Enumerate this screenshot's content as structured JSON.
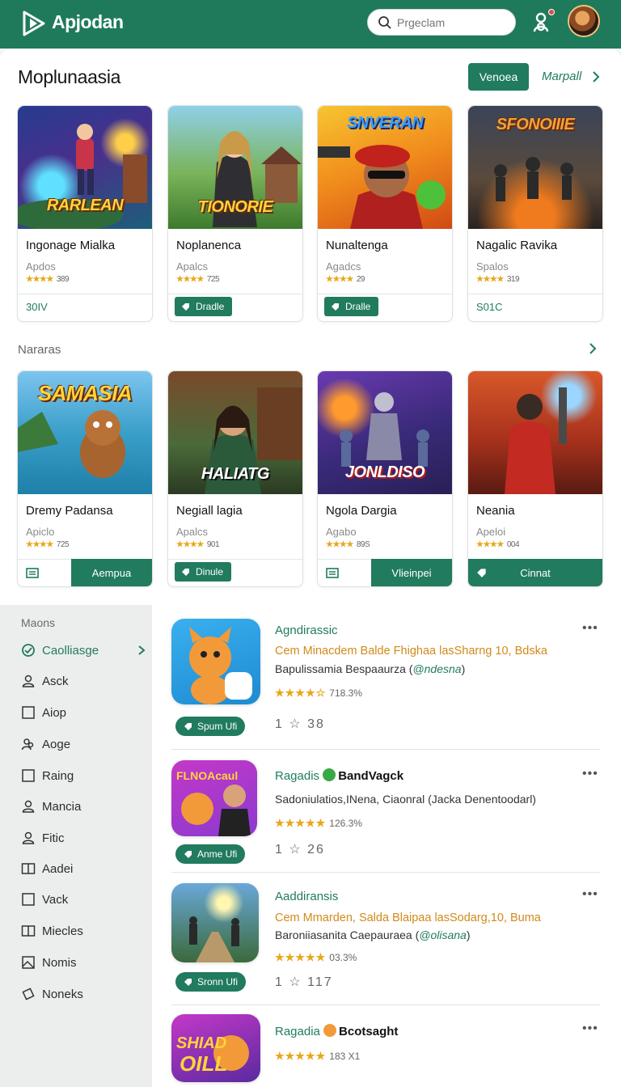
{
  "header": {
    "app_name": "Apjodan",
    "search_placeholder": "Prgeclam",
    "brand_color": "#1f7a5c"
  },
  "featured": {
    "title": "Moplunaasia",
    "view_button": "Venoea",
    "more_link": "Marpall",
    "cards": [
      {
        "art_text": "RARLEAN",
        "title": "Ingonage Mialka",
        "sub": "Apdos",
        "rating": "★★★★",
        "rating_count": "389",
        "action": "30IV",
        "action_type": "price"
      },
      {
        "art_text": "TIONORIE",
        "title": "Noplanenca",
        "sub": "Apalcs",
        "rating": "★★★★",
        "rating_count": "725",
        "action": "Dradle",
        "action_type": "pill"
      },
      {
        "art_text": "SNVERAN",
        "title": "Nunaltenga",
        "sub": "Agadcs",
        "rating": "★★★★",
        "rating_count": "29",
        "action": "Dralle",
        "action_type": "pill"
      },
      {
        "art_text": "SFONOIIIE",
        "title": "Nagalic Ravika",
        "sub": "Spalos",
        "rating": "★★★★",
        "rating_count": "319",
        "action": "S01C",
        "action_type": "price"
      }
    ]
  },
  "secondary": {
    "title": "Nararas",
    "cards": [
      {
        "art_text": "SAMASIA",
        "title": "Dremy Padansa",
        "sub": "Apiclo",
        "rating": "★★★★",
        "rating_count": "725",
        "action": "Aempua",
        "action_type": "wide"
      },
      {
        "art_text": "HALIATG",
        "title": "Negiall lagia",
        "sub": "Apalcs",
        "rating": "★★★★",
        "rating_count": "901",
        "action": "Dinule",
        "action_type": "pill"
      },
      {
        "art_text": "JONLDISO",
        "title": "Ngola Dargia",
        "sub": "Agabo",
        "rating": "★★★★",
        "rating_count": "89S",
        "action": "Vlieinpei",
        "action_type": "wide"
      },
      {
        "art_text": "",
        "title": "Neania",
        "sub": "Apeloi",
        "rating": "★★★★",
        "rating_count": "004",
        "action": "Cinnat",
        "action_type": "full"
      }
    ]
  },
  "sidebar": {
    "heading": "Maons",
    "items": [
      {
        "label": "Caolliasge",
        "icon": "category-icon"
      },
      {
        "label": "Asck",
        "icon": "user-icon"
      },
      {
        "label": "Aiop",
        "icon": "square-icon"
      },
      {
        "label": "Aoge",
        "icon": "group-icon"
      },
      {
        "label": "Raing",
        "icon": "square-icon"
      },
      {
        "label": "Mancia",
        "icon": "user-icon"
      },
      {
        "label": "Fitic",
        "icon": "user-icon"
      },
      {
        "label": "Aadei",
        "icon": "book-icon"
      },
      {
        "label": "Vack",
        "icon": "square-icon"
      },
      {
        "label": "Miecles",
        "icon": "book-icon"
      },
      {
        "label": "Nomis",
        "icon": "image-icon"
      },
      {
        "label": "Noneks",
        "icon": "tag-icon"
      }
    ]
  },
  "list": [
    {
      "name": "Agndirassic",
      "name_bold": "",
      "desc": "Cem Minacdem Balde Fhighaa lasSharng 10, Bdska",
      "dev": "Bapulissamia Bespaaurza (",
      "dev_handle": "@ndesna",
      "dev_end": ")",
      "stars": "★★★★☆",
      "rating": "718.3%",
      "meta_a": "1",
      "meta_b": "38",
      "get": "Spum Ufi"
    },
    {
      "name": "Ragadis ",
      "name_bold": "BandVagck",
      "desc": "",
      "dev": "Sadoniulatios,INena, Ciaonral (Jacka Denentoodarl)",
      "dev_handle": "",
      "dev_end": "",
      "stars": "★★★★★",
      "rating": "126.3%",
      "meta_a": "1",
      "meta_b": "26",
      "get": "Anme Ufi"
    },
    {
      "name": "Aaddiransis",
      "name_bold": "",
      "desc": "Cem Mmarden, Salda Blaipaa lasSodarg,10, Buma",
      "dev": "Baroniiasanita Caepauraea (",
      "dev_handle": "@olisana",
      "dev_end": ")",
      "stars": "★★★★★",
      "rating": "03.3%",
      "meta_a": "1",
      "meta_b": "117",
      "get": "Sronn Ufi"
    },
    {
      "name": "Ragadia ",
      "name_bold": "Bcotsaght",
      "desc": "",
      "dev": "",
      "dev_handle": "",
      "dev_end": "",
      "stars": "★★★★★",
      "rating": "183 X1",
      "meta_a": "",
      "meta_b": "",
      "get": ""
    }
  ]
}
